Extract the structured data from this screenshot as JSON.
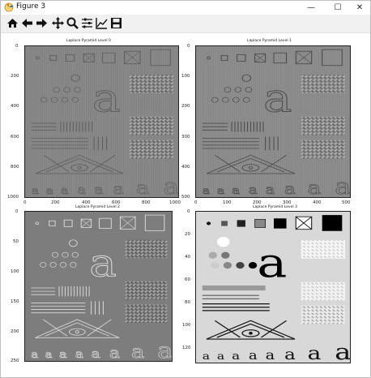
{
  "window": {
    "title": "Figure 3",
    "minimize_glyph": "—",
    "maximize_glyph": "☐",
    "close_glyph": "✕"
  },
  "toolbar": {
    "buttons": [
      "home-icon",
      "back-icon",
      "forward-icon",
      "pan-icon",
      "zoom-icon",
      "configure-subplots-icon",
      "edit-axes-icon",
      "save-icon"
    ]
  },
  "panels": [
    {
      "title": "Laplace Pyramid Level 0",
      "y_ticks": [
        "0",
        "200",
        "400",
        "600",
        "800",
        "1000"
      ],
      "x_ticks": [
        "0",
        "200",
        "400",
        "600",
        "800",
        "1000"
      ]
    },
    {
      "title": "Laplace Pyramid Level 1",
      "y_ticks": [
        "0",
        "100",
        "200",
        "300",
        "400",
        "500"
      ],
      "x_ticks": [
        "0",
        "100",
        "200",
        "300",
        "400",
        "500"
      ]
    },
    {
      "title": "Laplace Pyramid Level 2",
      "y_ticks": [
        "0",
        "50",
        "100",
        "150",
        "200",
        "250"
      ],
      "x_ticks": []
    },
    {
      "title": "Laplace Pyramid Level 3",
      "y_ticks": [
        "0",
        "20",
        "40",
        "60",
        "80",
        "100",
        "120"
      ],
      "x_ticks": []
    }
  ],
  "image_glyph": "a",
  "colors": {
    "level0_bg": "#8a8a8a",
    "level1_bg": "#8f8f8f",
    "level2_bg": "#7d7d7d",
    "level3_bg": "#d8d8d8",
    "toolbar_bg": "#f0f0f0"
  }
}
